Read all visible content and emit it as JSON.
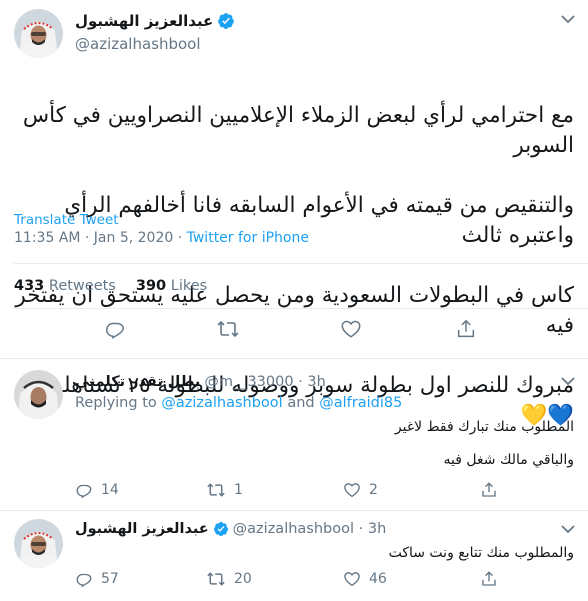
{
  "main_tweet": {
    "author_name": "عبدالعزيز الهشبول",
    "author_handle": "@azizalhashbool",
    "text_lines": [
      "مع احترامي لرأي لبعض الزملاء الإعلاميين النصراويين في كأس السوبر",
      "والتنقيص من قيمته في الأعوام السابقه  فانا  أخالفهم الرأي واعتبره ثالث",
      "كاس في البطولات السعودية ومن يحصل عليه يستحق ان يفتخر فيه",
      "مبروك للنصر اول بطولة سوبر ووصوله للبطولة ٢٥ تستاهلون 💙💛"
    ],
    "translate_label": "Translate Tweet",
    "timestamp": "11:35 AM · Jan 5, 2020 · ",
    "source": "Twitter for iPhone",
    "retweets_count": "433",
    "retweets_label": "Retweets",
    "likes_count": "390",
    "likes_label": "Likes"
  },
  "replies": [
    {
      "author_name": "بطل تقدر تكلمني",
      "author_handle": "@m__33000 · 3h",
      "replying_prefix": "Replying to ",
      "mention_1": "@azizalhashbool",
      "replying_and": " and ",
      "mention_2": "@alfraidi85",
      "text_line_1": "المطلوب منك تبارك فقط لاغير",
      "text_line_2": "والباقي مالك شغل فيه",
      "reply_count": "14",
      "retweet_count": "1",
      "like_count": "2"
    },
    {
      "author_name": "عبدالعزيز الهشبول",
      "author_handle": "@azizalhashbool · 3h",
      "text_line_1": "والمطلوب منك تتابع ونت ساكت",
      "reply_count": "57",
      "retweet_count": "20",
      "like_count": "46"
    }
  ],
  "colors": {
    "accent": "#1da1f2",
    "muted": "#657786",
    "text": "#14171a",
    "divider": "#e6ecf0"
  },
  "icons": [
    "verified-badge-icon",
    "chevron-down-icon",
    "reply-icon",
    "retweet-icon",
    "like-icon",
    "share-icon"
  ]
}
